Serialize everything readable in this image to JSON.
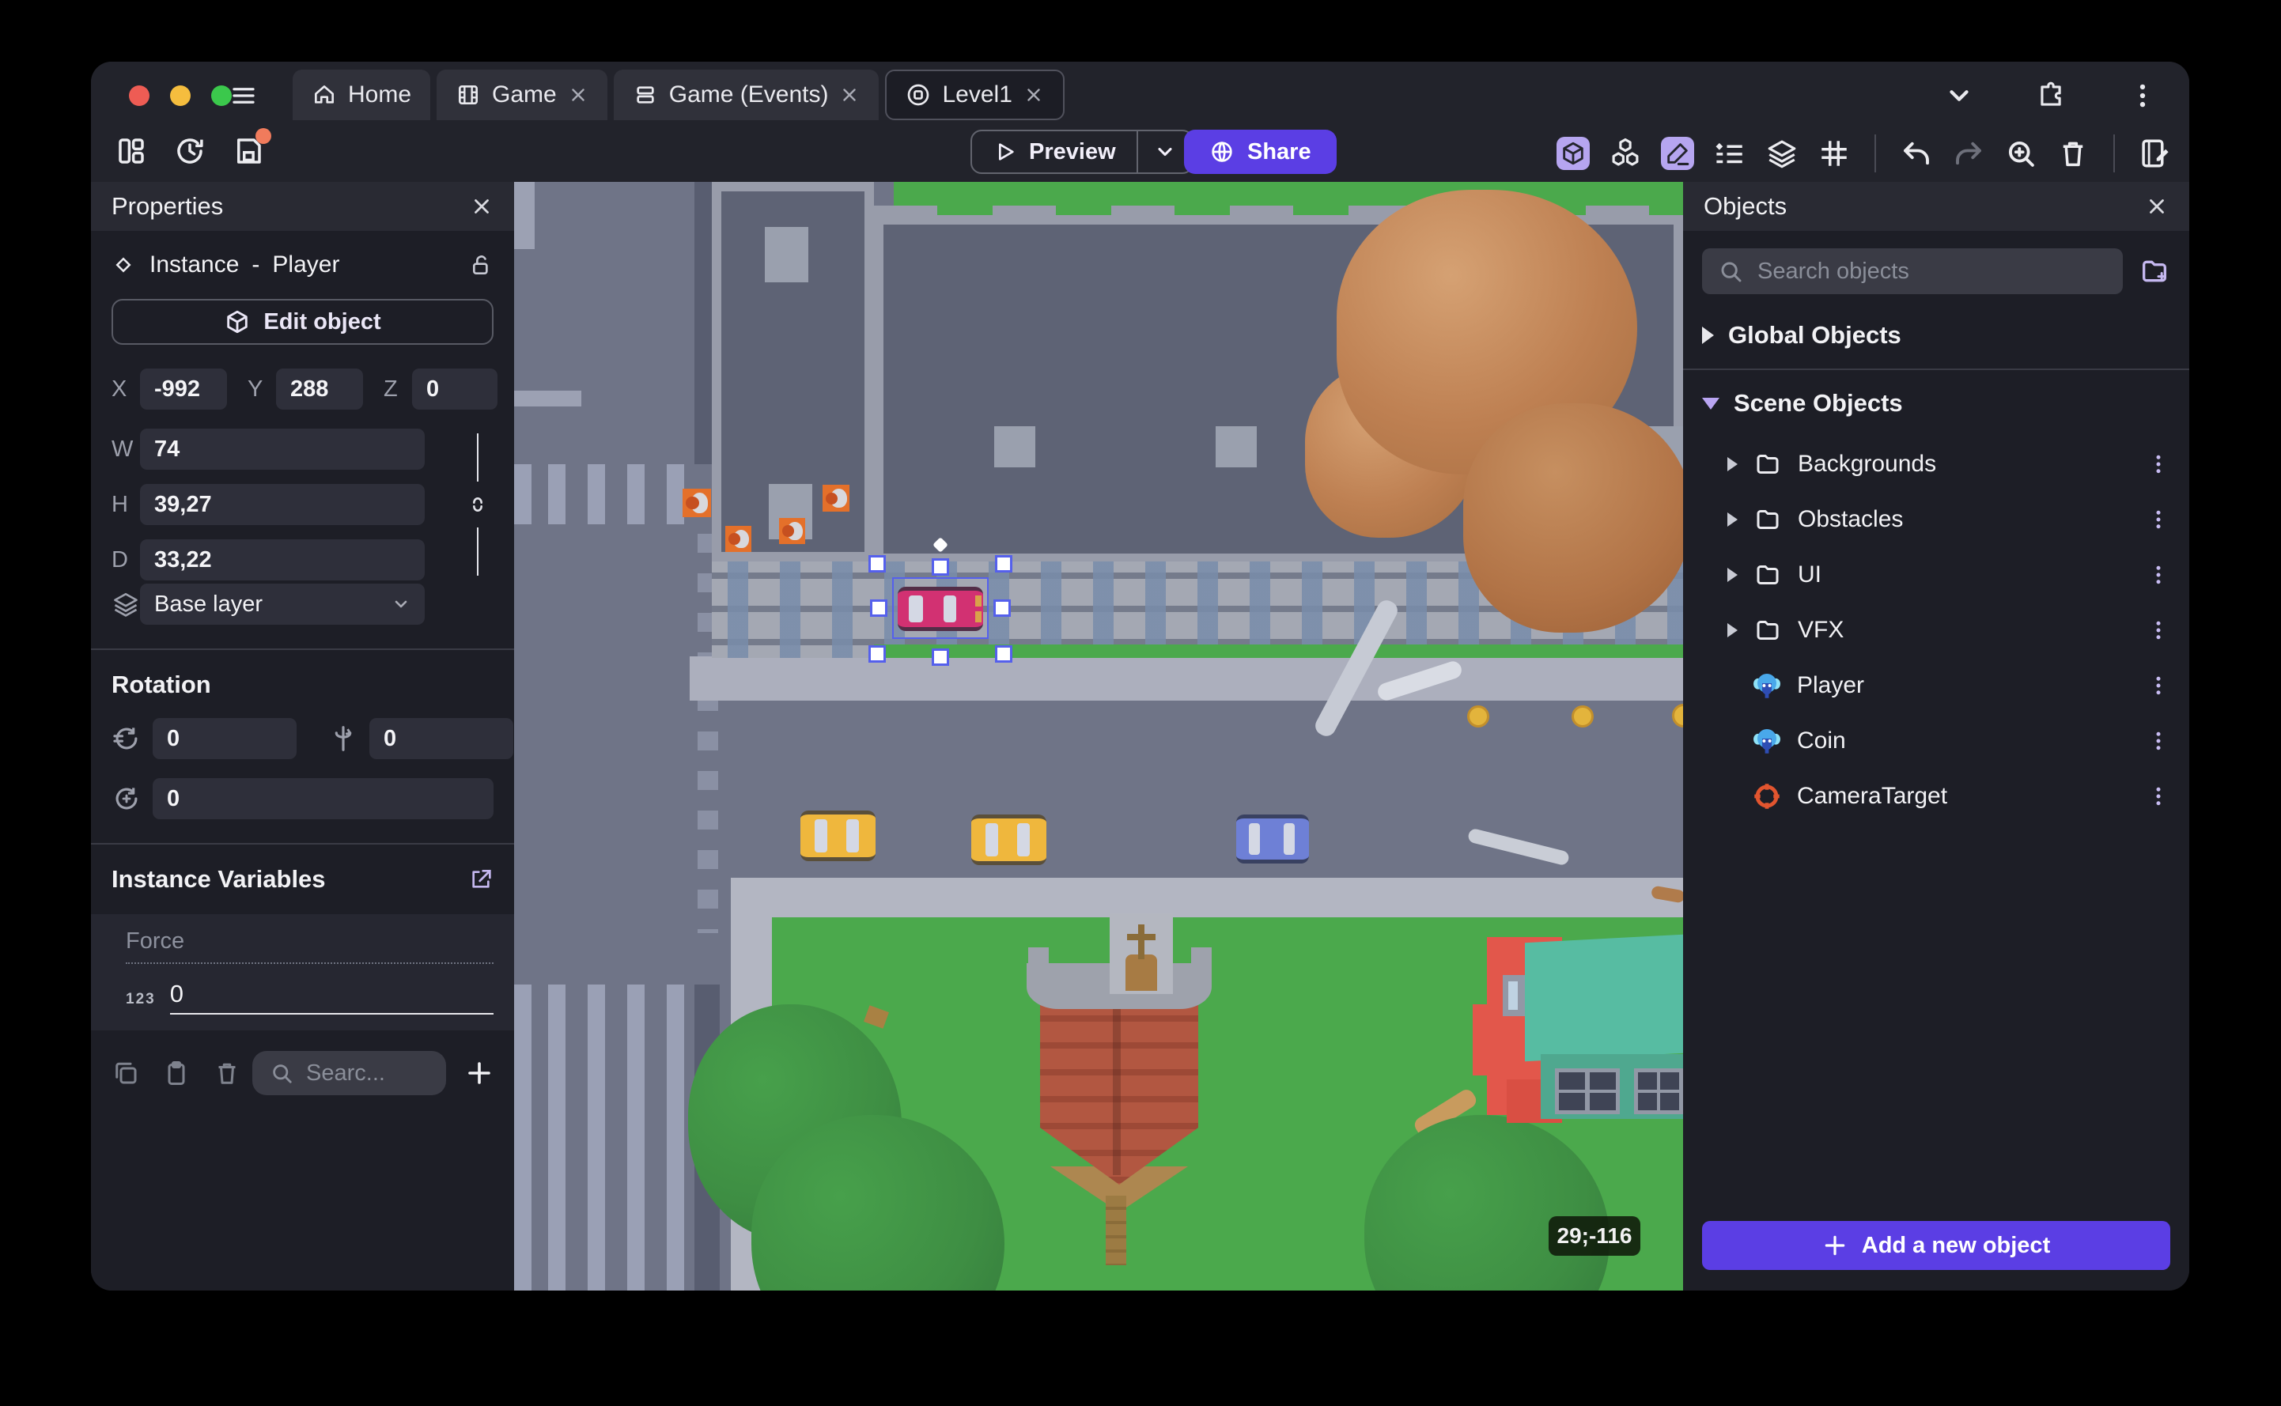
{
  "window": {
    "tabs": [
      {
        "label": "Home",
        "icon": "home-icon",
        "closable": false
      },
      {
        "label": "Game",
        "icon": "film-icon",
        "closable": true
      },
      {
        "label": "Game (Events)",
        "icon": "rows-icon",
        "closable": true
      },
      {
        "label": "Level1",
        "icon": "scene-icon",
        "closable": true,
        "active": true
      }
    ]
  },
  "toolbar": {
    "preview_label": "Preview",
    "share_label": "Share",
    "left_icons": [
      "dashboard-icon",
      "history-icon",
      "save-icon"
    ],
    "right_icons": [
      "cube-3d-icon",
      "objects-cubes-icon",
      "pencil-icon",
      "instances-list-icon",
      "layers-icon",
      "grid-icon",
      "undo-icon",
      "redo-icon",
      "zoom-in-icon",
      "trash-icon",
      "events-sheet-icon"
    ]
  },
  "properties": {
    "title": "Properties",
    "instance_kind": "Instance",
    "separator": "-",
    "object_name": "Player",
    "edit_object_label": "Edit object",
    "x_label": "X",
    "x": "-992",
    "y_label": "Y",
    "y": "288",
    "z_label": "Z",
    "z": "0",
    "w_label": "W",
    "w": "74",
    "h_label": "H",
    "h": "39,27",
    "d_label": "D",
    "d": "33,22",
    "layer": "Base layer",
    "rotation_title": "Rotation",
    "rot_x": "0",
    "rot_y": "0",
    "rot_z": "0",
    "variables_title": "Instance Variables",
    "variable_name": "Force",
    "variable_type": "123",
    "variable_value": "0",
    "search_placeholder": "Searc..."
  },
  "objects_panel": {
    "title": "Objects",
    "search_placeholder": "Search objects",
    "global_group": "Global Objects",
    "scene_group": "Scene Objects",
    "folders": [
      "Backgrounds",
      "Obstacles",
      "UI",
      "VFX"
    ],
    "items": [
      {
        "name": "Player",
        "icon": "monkey-icon"
      },
      {
        "name": "Coin",
        "icon": "monkey-icon"
      },
      {
        "name": "CameraTarget",
        "icon": "target-icon"
      }
    ],
    "add_button": "Add a new object"
  },
  "canvas": {
    "coordinates_badge": "29;-116",
    "selected_object": "Player"
  },
  "colors": {
    "accent": "#5B3EE4",
    "active_icon_bg": "#B6A5F0",
    "selection": "#5560EC",
    "save_dot": "#F07B5C",
    "traffic_red": "#EE5C54",
    "traffic_yellow": "#F5BD3E",
    "traffic_green": "#3BC84C"
  }
}
